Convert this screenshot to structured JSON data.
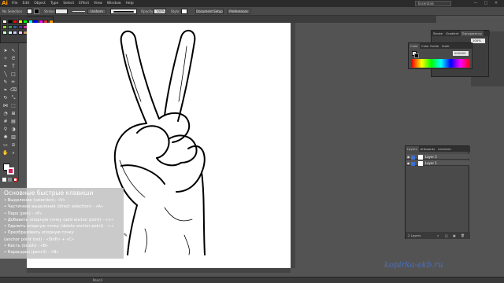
{
  "menubar": {
    "logo": "Ai",
    "items": [
      "File",
      "Edit",
      "Object",
      "Type",
      "Select",
      "Effect",
      "View",
      "Window",
      "Help"
    ],
    "workspace": "Essentials",
    "window_buttons": [
      "—",
      "□",
      "✕"
    ]
  },
  "controlbar": {
    "selection_label": "No Selection",
    "stroke_label": "Stroke:",
    "stroke_value": "",
    "uniform_label": "Uniform",
    "opacity_label": "Opacity:",
    "opacity_value": "100%",
    "style_label": "Style:",
    "doc_setup": "Document Setup",
    "preferences": "Preferences"
  },
  "right_panel": {
    "tabs": [
      "Stroke",
      "Gradient",
      "Transparency"
    ],
    "opacity_value": "100%"
  },
  "color_panel": {
    "tabs": [
      "Color",
      "Color Guide",
      "Kuler"
    ],
    "hex_value": "000000"
  },
  "layers_panel": {
    "tabs": [
      "Layers",
      "Artboards",
      "Libraries"
    ],
    "rows": [
      "Layer 2",
      "Layer 1"
    ],
    "footer": "2 Layers"
  },
  "statusbar": {
    "tool": "Pencil"
  },
  "overlay": {
    "title": "Основные быстрые клавиши",
    "lines": [
      "• Выделение (selection)- «V»",
      "• Частичное выделение (direct selection) - «A»",
      "• Перо (pen) - «P»",
      "• Добавить опорную точку (add anchor point) - «+»",
      "• Удалить опорную точку (delete anchor point) - «-»",
      "• Преобразовать опорную точку",
      "  (anchor point tool) - «Shift» + «C»",
      "• Кисть (brush) - «B»",
      "• Карандаш (pencil) - «N»"
    ]
  },
  "watermark": "kopirka-ekb.ru",
  "colors": {
    "accent_orange": "#ff9a00",
    "watermark_blue": "#4a70c2",
    "layer_blue": "#3b6fd6",
    "fill_swatch_pink": "#d81b60"
  }
}
